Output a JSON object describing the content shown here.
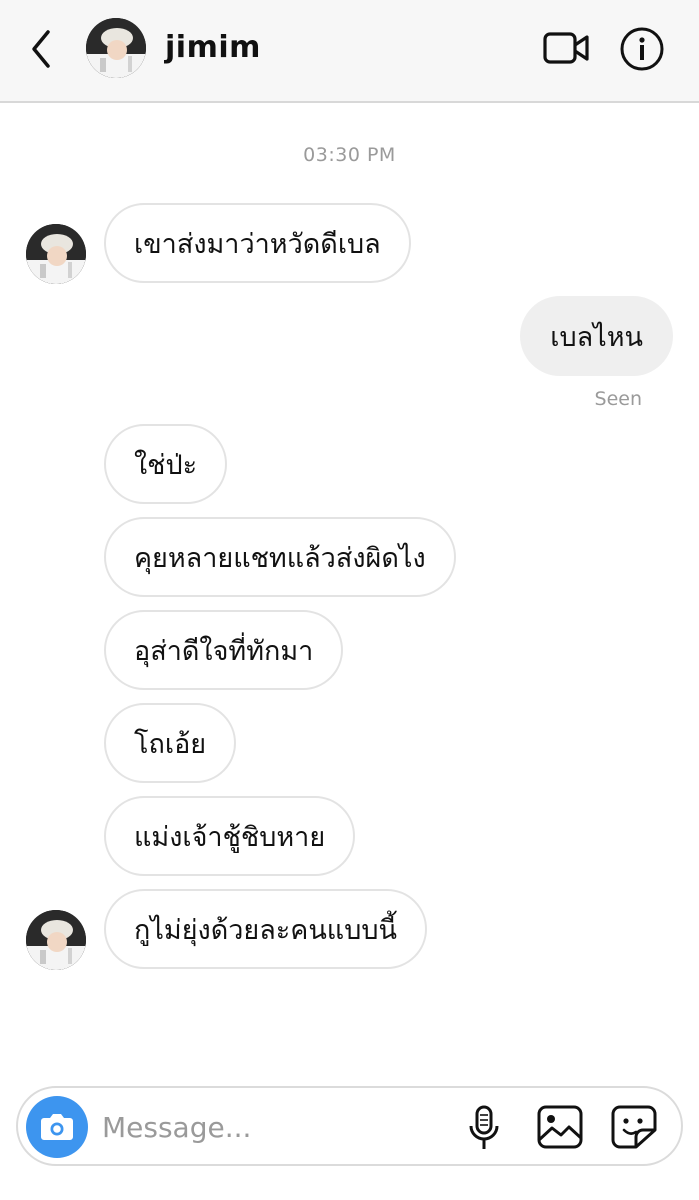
{
  "header": {
    "contact_name": "jimim",
    "back_icon": "chevron-left-icon",
    "video_icon": "video-camera-icon",
    "info_icon": "info-icon"
  },
  "thread": {
    "timestamp": "03:30 PM",
    "messages": [
      {
        "from": "them",
        "text": "เขาส่งมาว่าหวัดดีเบล"
      },
      {
        "from": "me",
        "text": "เบลไหน"
      },
      {
        "from": "them",
        "text": "ใช่ป่ะ"
      },
      {
        "from": "them",
        "text": "คุยหลายแชทแล้วส่งผิดไง"
      },
      {
        "from": "them",
        "text": "อุส่าดีใจที่ทักมา"
      },
      {
        "from": "them",
        "text": "โถเอ้ย"
      },
      {
        "from": "them",
        "text": "แม่งเจ้าชู้ชิบหาย"
      },
      {
        "from": "them",
        "text": "กูไม่ยุ่งด้วยละคนแบบนี้"
      }
    ],
    "seen_label": "Seen"
  },
  "composer": {
    "placeholder": "Message...",
    "value": "",
    "camera_icon": "camera-icon",
    "mic_icon": "microphone-icon",
    "gallery_icon": "image-gallery-icon",
    "sticker_icon": "sticker-icon"
  },
  "colors": {
    "camera_button": "#3d95ef",
    "incoming_bubble_border": "#e3e3e3",
    "outgoing_bubble_bg": "#efefef",
    "meta_text": "#9a9a9a"
  }
}
